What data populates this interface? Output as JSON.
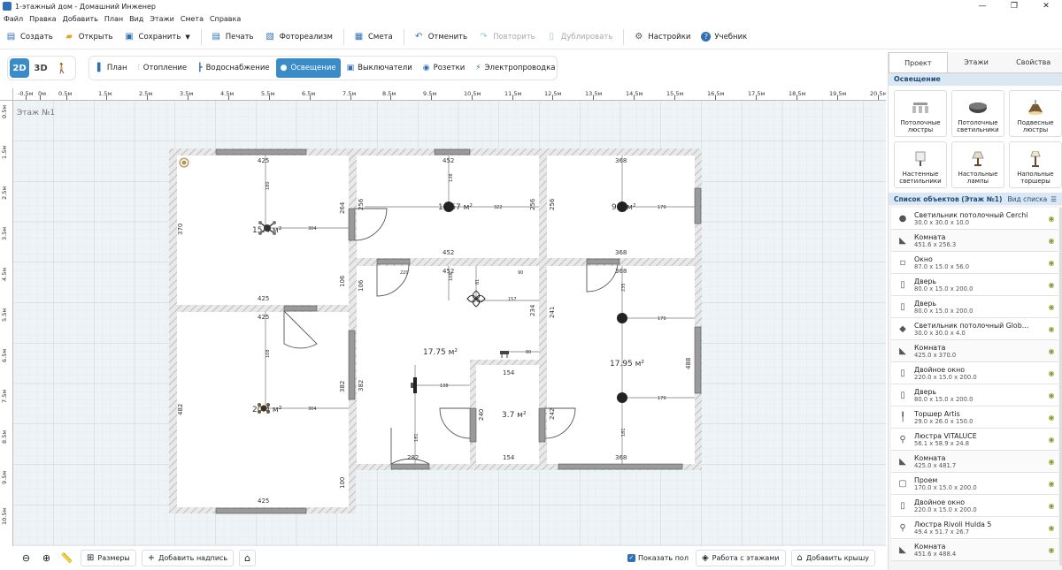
{
  "window": {
    "title": "1-этажный дом - Домашний Инженер",
    "controls": [
      "—",
      "❐",
      "✕"
    ]
  },
  "menu": [
    "Файл",
    "Правка",
    "Добавить",
    "План",
    "Вид",
    "Этажи",
    "Смета",
    "Справка"
  ],
  "toolbar": {
    "create": "Создать",
    "open": "Открыть",
    "save": "Сохранить",
    "print": "Печать",
    "photoreal": "Фотореализм",
    "estimate": "Смета",
    "undo": "Отменить",
    "redo": "Повторить",
    "duplicate": "Дублировать",
    "settings": "Настройки",
    "tutorial": "Учебник"
  },
  "views": [
    "2D",
    "3D"
  ],
  "layers": [
    {
      "label": "План",
      "icon": "▌"
    },
    {
      "label": "Отопление",
      "icon": "⫶"
    },
    {
      "label": "Водоснабжение",
      "icon": "┣"
    },
    {
      "label": "Освещение",
      "icon": "●"
    },
    {
      "label": "Выключатели",
      "icon": "▣"
    },
    {
      "label": "Розетки",
      "icon": "◉"
    },
    {
      "label": "Электропроводка",
      "icon": "⚡"
    }
  ],
  "active_layer": "Освещение",
  "ruler": {
    "h": [
      "-0.5м",
      "0м",
      "0.5м",
      "1.5м",
      "2.5м",
      "3.5м",
      "4.5м",
      "5.5м",
      "6.5м",
      "7.5м",
      "8.5м",
      "9.5м",
      "10.5м",
      "11.5м",
      "12.5м",
      "13.5м",
      "14.5м",
      "15.5м",
      "16.5м",
      "17.5м",
      "18.5м",
      "19.5м",
      "20.5м"
    ],
    "v": [
      "0.5м",
      "1.5м",
      "2.5м",
      "3.5м",
      "4.5м",
      "5.5м",
      "6.5м",
      "7.5м",
      "8.5м",
      "9.5м",
      "10.5м"
    ]
  },
  "floor_label": "Этаж №1",
  "plan": {
    "dims": [
      "425",
      "452",
      "368",
      "370",
      "264",
      "256",
      "256",
      "256",
      "452",
      "368",
      "425",
      "106",
      "106",
      "452",
      "368",
      "234",
      "241",
      "425",
      "382",
      "382",
      "154",
      "240",
      "242",
      "488",
      "482",
      "282",
      "154",
      "368",
      "425",
      "100"
    ],
    "areas": [
      "15.4 м²",
      "11.57 м²",
      "9.4 м²",
      "17.75 м²",
      "17.95 м²",
      "3.7 м²",
      "20.4 м²"
    ],
    "wires": [
      "180",
      "304",
      "138",
      "322",
      "179",
      "108",
      "157",
      "179",
      "179",
      "304",
      "138",
      "108",
      "80",
      "181",
      "90",
      "81",
      "220",
      "235",
      "181"
    ]
  },
  "bottom": {
    "sizes": "Размеры",
    "add_label": "Добавить надпись",
    "show_floor": "Показать пол",
    "floors_work": "Работа с этажами",
    "add_roof": "Добавить крышу"
  },
  "panel": {
    "tabs": [
      "Проект",
      "Этажи",
      "Свойства"
    ],
    "section": "Освещение",
    "categories": [
      "Потолочные люстры",
      "Потолочные светильники",
      "Подвесные люстры",
      "Настенные светильники",
      "Настольные лампы",
      "Напольные торшеры"
    ],
    "list_title": "Список объектов (Этаж №1)",
    "list_view": "Вид списка",
    "objects": [
      {
        "name": "Светильник потолочный Cerchi",
        "dims": "30.0 x 30.0 x 10.0",
        "icon": "●",
        "room": false
      },
      {
        "name": "Комната",
        "dims": "451.6 x 256.3",
        "icon": "◣",
        "room": true
      },
      {
        "name": "Окно",
        "dims": "87.0 x 15.0 x 56.0",
        "icon": "▫",
        "room": false
      },
      {
        "name": "Дверь",
        "dims": "80.0 x 15.0 x 200.0",
        "icon": "▯",
        "room": false
      },
      {
        "name": "Дверь",
        "dims": "80.0 x 15.0 x 200.0",
        "icon": "▯",
        "room": false
      },
      {
        "name": "Светильник потолочный Globo ...",
        "dims": "30.0 x 30.0 x 4.0",
        "icon": "◆",
        "room": false
      },
      {
        "name": "Комната",
        "dims": "425.0 x 370.0",
        "icon": "◣",
        "room": true
      },
      {
        "name": "Двойное окно",
        "dims": "220.0 x 15.0 x 200.0",
        "icon": "▯",
        "room": false
      },
      {
        "name": "Дверь",
        "dims": "80.0 x 15.0 x 200.0",
        "icon": "▯",
        "room": false
      },
      {
        "name": "Торшер Artis",
        "dims": "29.0 x 26.0 x 150.0",
        "icon": "╿",
        "room": false
      },
      {
        "name": "Люстра VITALUCE",
        "dims": "56.1 x 58.9 x 24.8",
        "icon": "⚲",
        "room": false
      },
      {
        "name": "Комната",
        "dims": "425.0 x 481.7",
        "icon": "◣",
        "room": true
      },
      {
        "name": "Проем",
        "dims": "170.0 x 15.0 x 200.0",
        "icon": "▢",
        "room": false
      },
      {
        "name": "Двойное окно",
        "dims": "220.0 x 15.0 x 200.0",
        "icon": "▯",
        "room": false
      },
      {
        "name": "Люстра Rivoli Hulda 5",
        "dims": "49.4 x 51.7 x 26.7",
        "icon": "⚲",
        "room": false
      },
      {
        "name": "Комната",
        "dims": "451.6 x 488.4",
        "icon": "◣",
        "room": true
      }
    ]
  },
  "colors": {
    "accent": "#3a8cc9",
    "wall": "#cfcfcf",
    "window": "#8d8d8d"
  }
}
